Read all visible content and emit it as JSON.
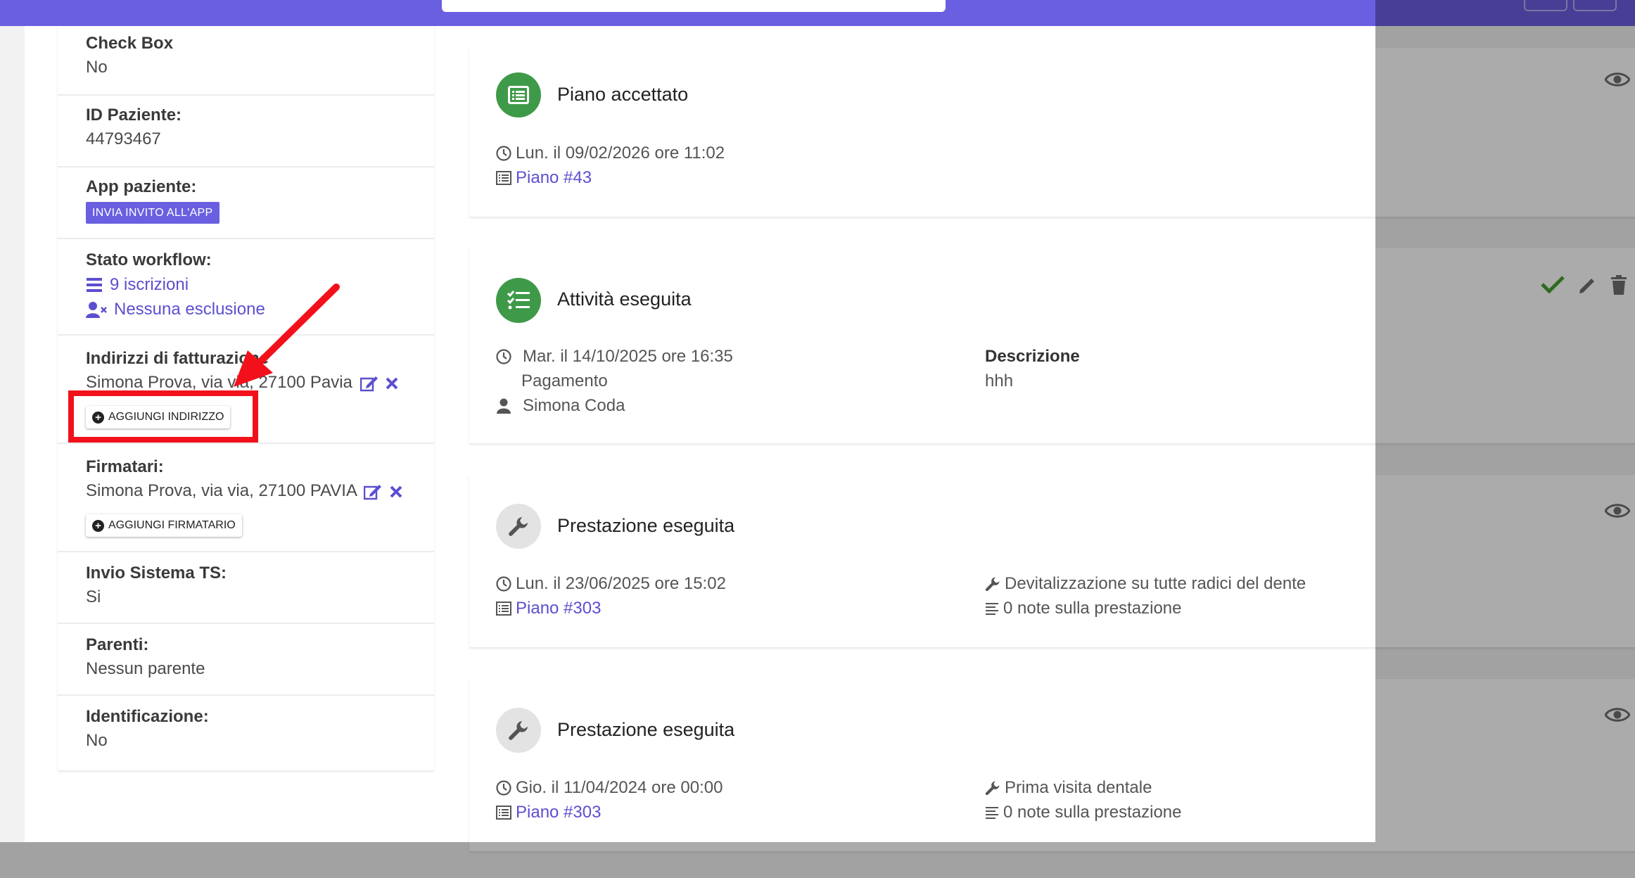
{
  "patient_info": {
    "check_box": {
      "label": "Check Box",
      "value": "No"
    },
    "id_paziente": {
      "label": "ID Paziente:",
      "value": "44793467"
    },
    "app_paziente": {
      "label": "App paziente:",
      "button": "INVIA INVITO ALL'APP"
    },
    "stato_workflow": {
      "label": "Stato workflow:",
      "iscrizioni": "9 iscrizioni",
      "esclusione": "Nessuna esclusione"
    },
    "indirizzi": {
      "label": "Indirizzi di fatturazione",
      "value": "Simona Prova, via via, 27100 Pavia",
      "button": "AGGIUNGI INDIRIZZO"
    },
    "firmatari": {
      "label": "Firmatari:",
      "value": "Simona Prova, via via, 27100 PAVIA",
      "button": "AGGIUNGI FIRMATARIO"
    },
    "invio_ts": {
      "label": "Invio Sistema TS:",
      "value": "Si"
    },
    "parenti": {
      "label": "Parenti:",
      "value": "Nessun parente"
    },
    "identificazione": {
      "label": "Identificazione:",
      "value": "No"
    }
  },
  "timeline": [
    {
      "title": "Piano accettato",
      "date": "Lun. il 09/02/2026 ore 11:02",
      "link": "Piano #43"
    },
    {
      "title": "Attività eseguita",
      "date": "Mar. il 14/10/2025 ore 16:35",
      "type": "Pagamento",
      "user": "Simona Coda",
      "desc_label": "Descrizione",
      "desc_value": "hhh"
    },
    {
      "title": "Prestazione eseguita",
      "date": "Lun. il 23/06/2025 ore 15:02",
      "link": "Piano #303",
      "service": "Devitalizzazione su tutte radici del dente",
      "notes": "0 note sulla prestazione"
    },
    {
      "title": "Prestazione eseguita",
      "date": "Gio. il 11/04/2024 ore 00:00",
      "link": "Piano #303",
      "service": "Prima visita dentale",
      "notes": "0 note sulla prestazione"
    }
  ],
  "colors": {
    "accent": "#6a5fe0",
    "link": "#5b4fd0",
    "success": "#3e9a48",
    "highlight": "#f2111b"
  }
}
